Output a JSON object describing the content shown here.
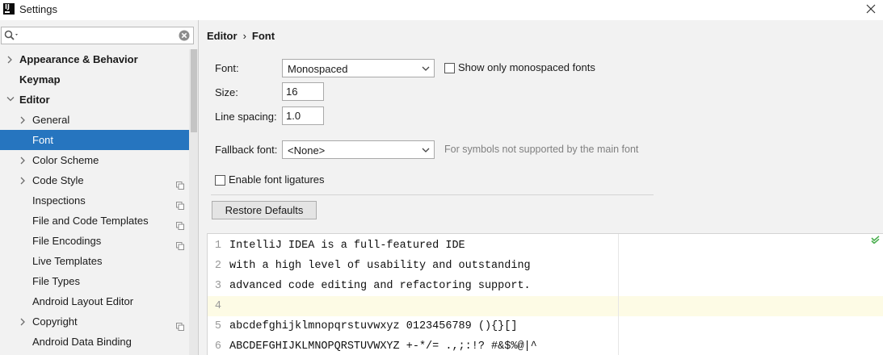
{
  "window": {
    "app_icon_text": "IJ",
    "title": "Settings"
  },
  "sidebar": {
    "search": {
      "value": "",
      "placeholder": ""
    },
    "items": [
      {
        "label": "Appearance & Behavior",
        "arrow": true,
        "bold": true,
        "level": 0
      },
      {
        "label": "Keymap",
        "arrow": false,
        "bold": true,
        "level": 0
      },
      {
        "label": "Editor",
        "arrow": true,
        "expanded": true,
        "bold": true,
        "level": 0
      },
      {
        "label": "General",
        "arrow": true,
        "level": 1
      },
      {
        "label": "Font",
        "arrow": false,
        "level": 1,
        "selected": true
      },
      {
        "label": "Color Scheme",
        "arrow": true,
        "level": 1
      },
      {
        "label": "Code Style",
        "arrow": true,
        "level": 1,
        "copy_icon": true
      },
      {
        "label": "Inspections",
        "arrow": false,
        "level": 1,
        "copy_icon": true
      },
      {
        "label": "File and Code Templates",
        "arrow": false,
        "level": 1,
        "copy_icon": true
      },
      {
        "label": "File Encodings",
        "arrow": false,
        "level": 1,
        "copy_icon": true
      },
      {
        "label": "Live Templates",
        "arrow": false,
        "level": 1
      },
      {
        "label": "File Types",
        "arrow": false,
        "level": 1
      },
      {
        "label": "Android Layout Editor",
        "arrow": false,
        "level": 1
      },
      {
        "label": "Copyright",
        "arrow": true,
        "level": 1,
        "copy_icon": true
      },
      {
        "label": "Android Data Binding",
        "arrow": false,
        "level": 1
      }
    ]
  },
  "breadcrumb": {
    "parent": "Editor",
    "separator": "›",
    "current": "Font"
  },
  "form": {
    "font_label": "Font:",
    "font_value": "Monospaced",
    "mono_only_label": "Show only monospaced fonts",
    "size_label": "Size:",
    "size_value": "16",
    "line_spacing_label": "Line spacing:",
    "line_spacing_value": "1.0",
    "fallback_label": "Fallback font:",
    "fallback_value": "<None>",
    "fallback_hint": "For symbols not supported by the main font",
    "ligatures_label": "Enable font ligatures",
    "restore_label": "Restore Defaults"
  },
  "preview": {
    "lines": [
      {
        "num": "1",
        "text": "IntelliJ IDEA is a full-featured IDE"
      },
      {
        "num": "2",
        "text": "with a high level of usability and outstanding"
      },
      {
        "num": "3",
        "text": "advanced code editing and refactoring support."
      },
      {
        "num": "4",
        "text": ""
      },
      {
        "num": "5",
        "text": "abcdefghijklmnopqrstuvwxyz 0123456789 (){}[]"
      },
      {
        "num": "6",
        "text": "ABCDEFGHIJKLMNOPQRSTUVWXYZ +-*/= .,;:!? #&$%@|^"
      }
    ],
    "current_line": 4
  },
  "colors": {
    "selection": "#2675bf",
    "current_line": "#fdfbe5",
    "ok": "#4caf50"
  }
}
